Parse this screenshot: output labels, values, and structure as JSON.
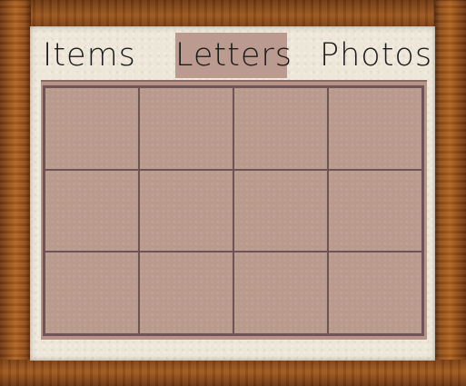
{
  "tabs": [
    {
      "label": "Items",
      "selected": false
    },
    {
      "label": "Letters",
      "selected": true
    },
    {
      "label": "Photos",
      "selected": false
    }
  ],
  "grid": {
    "columns": 4,
    "rows": 3,
    "slots_filled": 0
  }
}
